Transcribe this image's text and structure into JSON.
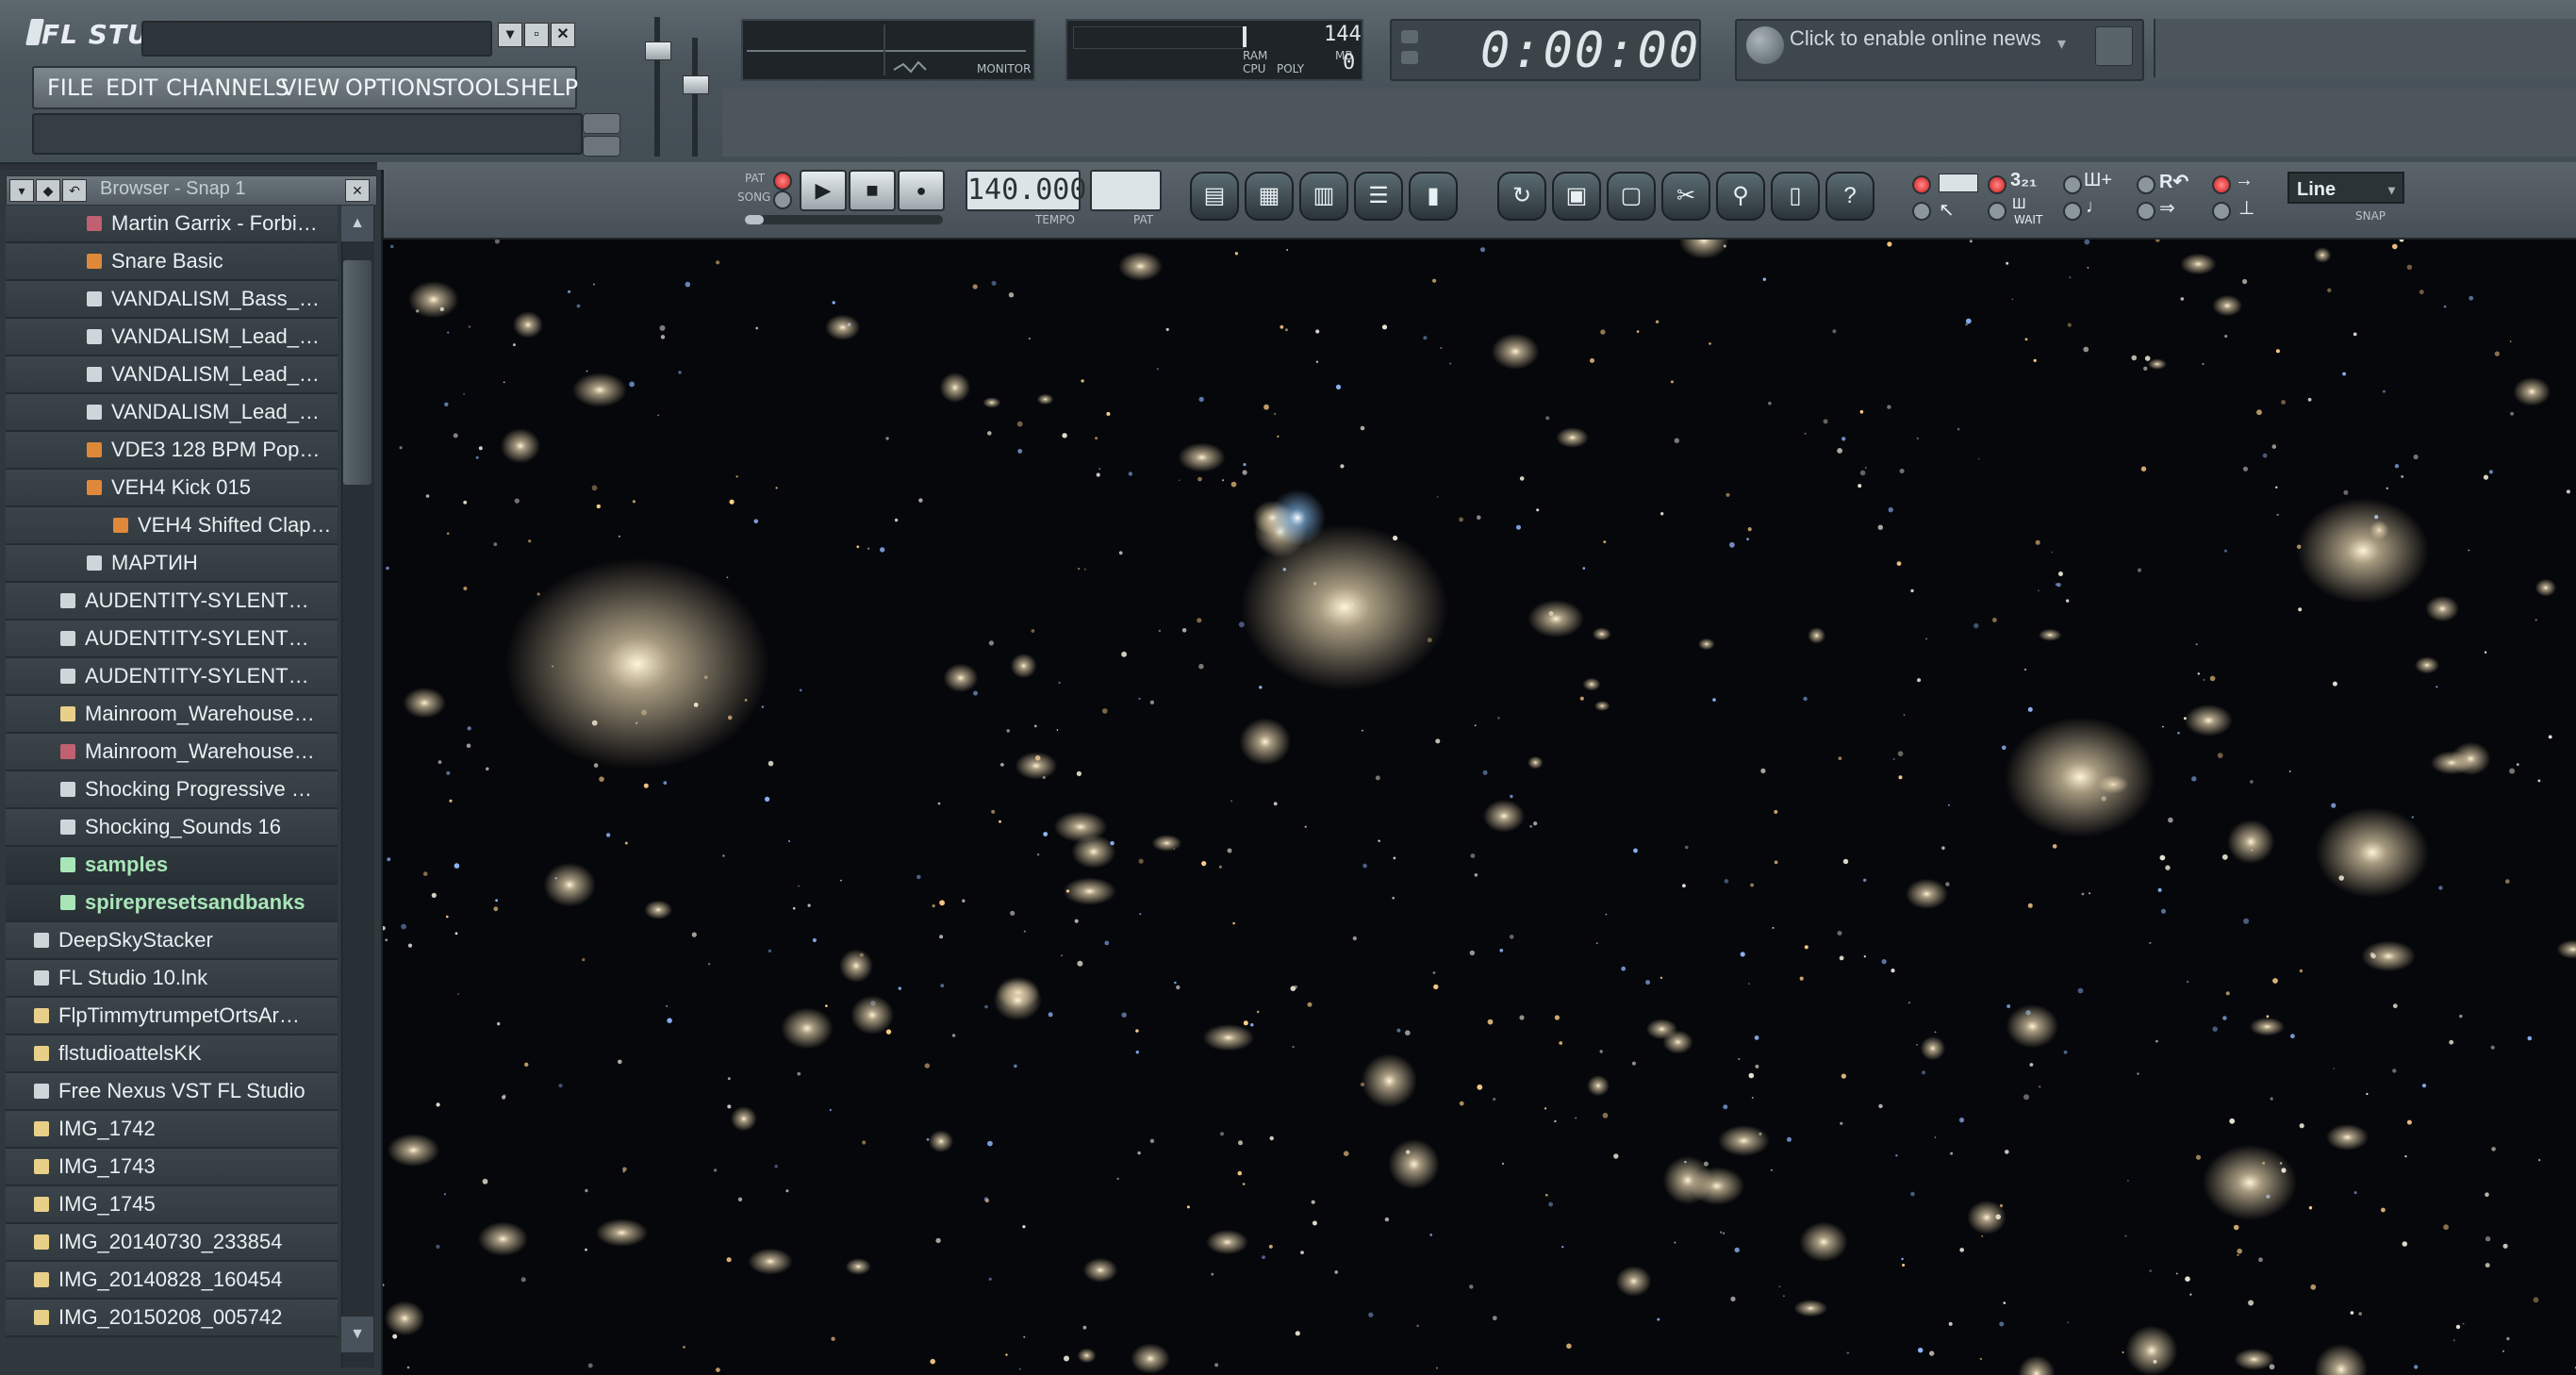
{
  "app": {
    "logo": "FL STUDIO",
    "window_buttons": [
      "▾",
      "▫",
      "✕"
    ]
  },
  "menu": [
    "FILE",
    "EDIT",
    "CHANNELS",
    "VIEW",
    "OPTIONS",
    "TOOLS",
    "HELP"
  ],
  "monitor": {
    "label": "MONITOR"
  },
  "cpu": {
    "cpu_label": "CPU",
    "poly_label": "POLY",
    "ram_label": "RAM",
    "mb_label": "MB",
    "ram_value": "144",
    "poly_value": "0"
  },
  "clock": {
    "time": "0:00:00"
  },
  "news": {
    "text": "Click to enable online news"
  },
  "transport": {
    "pat_label": "PAT",
    "song_label": "SONG",
    "tempo": "140.000",
    "tempo_label": "TEMPO",
    "pat_box_label": "PAT",
    "snap_value": "Line",
    "snap_label": "SNAP",
    "wait_label": "WAIT"
  },
  "browser": {
    "title": "Browser - Snap 1",
    "items": [
      {
        "label": "Martin Garrix - Forbi…",
        "icon": "file-icon",
        "color": "#c06070",
        "indent": 2
      },
      {
        "label": "Snare Basic",
        "icon": "audio-icon",
        "color": "#e0883a",
        "indent": 2
      },
      {
        "label": "VANDALISM_Bass_…",
        "icon": "vst-icon",
        "color": "#cfd6da",
        "indent": 2
      },
      {
        "label": "VANDALISM_Lead_…",
        "icon": "vst-icon",
        "color": "#cfd6da",
        "indent": 2
      },
      {
        "label": "VANDALISM_Lead_…",
        "icon": "vst-icon",
        "color": "#cfd6da",
        "indent": 2
      },
      {
        "label": "VANDALISM_Lead_…",
        "icon": "vst-icon",
        "color": "#cfd6da",
        "indent": 2
      },
      {
        "label": "VDE3 128 BPM Pop…",
        "icon": "audio-icon",
        "color": "#e0883a",
        "indent": 2
      },
      {
        "label": "VEH4 Kick 015",
        "icon": "audio-icon",
        "color": "#e0883a",
        "indent": 2
      },
      {
        "label": "VEH4 Shifted Clap…",
        "icon": "audio-icon",
        "color": "#e0883a",
        "indent": 3
      },
      {
        "label": "МАРТИН",
        "icon": "file-icon",
        "color": "#cfd6da",
        "indent": 2
      },
      {
        "label": "AUDENTITY-SYLENT…",
        "icon": "vst-icon",
        "color": "#cfd6da",
        "indent": 1
      },
      {
        "label": "AUDENTITY-SYLENT…",
        "icon": "vst-icon",
        "color": "#cfd6da",
        "indent": 1
      },
      {
        "label": "AUDENTITY-SYLENT…",
        "icon": "vst-icon",
        "color": "#cfd6da",
        "indent": 1
      },
      {
        "label": "Mainroom_Warehouse…",
        "icon": "zip-icon",
        "color": "#e8d088",
        "indent": 1
      },
      {
        "label": "Mainroom_Warehouse…",
        "icon": "file-icon",
        "color": "#c06070",
        "indent": 1
      },
      {
        "label": "Shocking Progressive …",
        "icon": "vst-icon",
        "color": "#cfd6da",
        "indent": 1
      },
      {
        "label": "Shocking_Sounds 16",
        "icon": "vst-icon",
        "color": "#cfd6da",
        "indent": 1
      },
      {
        "label": "samples",
        "icon": "folder-icon",
        "color": "#a8e6b8",
        "indent": 1,
        "folder": true
      },
      {
        "label": "spirepresetsandbanks",
        "icon": "folder-icon",
        "color": "#a8e6b8",
        "indent": 1,
        "folder": true
      },
      {
        "label": "DeepSkyStacker",
        "icon": "app-icon",
        "color": "#cfd6da",
        "indent": 0
      },
      {
        "label": "FL Studio 10.lnk",
        "icon": "file-icon",
        "color": "#cfd6da",
        "indent": 0
      },
      {
        "label": "FlpTimmytrumpetOrtsAr…",
        "icon": "zip-icon",
        "color": "#e8d088",
        "indent": 0
      },
      {
        "label": "flstudioattelsKK",
        "icon": "zip-icon",
        "color": "#e8d088",
        "indent": 0
      },
      {
        "label": "Free Nexus VST FL Studio",
        "icon": "file-icon",
        "color": "#cfd6da",
        "indent": 0
      },
      {
        "label": "IMG_1742",
        "icon": "zip-icon",
        "color": "#e8d088",
        "indent": 0
      },
      {
        "label": "IMG_1743",
        "icon": "zip-icon",
        "color": "#e8d088",
        "indent": 0
      },
      {
        "label": "IMG_1745",
        "icon": "zip-icon",
        "color": "#e8d088",
        "indent": 0
      },
      {
        "label": "IMG_20140730_233854",
        "icon": "zip-icon",
        "color": "#e8d088",
        "indent": 0
      },
      {
        "label": "IMG_20140828_160454",
        "icon": "zip-icon",
        "color": "#e8d088",
        "indent": 0
      },
      {
        "label": "IMG_20150208_005742",
        "icon": "zip-icon",
        "color": "#e8d088",
        "indent": 0
      }
    ]
  },
  "toolbar_icons": [
    "playlist-icon",
    "step-sequencer-icon",
    "piano-roll-icon",
    "browser-icon",
    "mixer-icon",
    "undo-icon",
    "save-icon",
    "save-as-icon",
    "cut-icon",
    "find-icon",
    "notes-icon",
    "help-icon"
  ],
  "colors": {
    "accent_red": "#d01818",
    "folder_green": "#a8e6b8",
    "audio_orange": "#e0883a"
  }
}
